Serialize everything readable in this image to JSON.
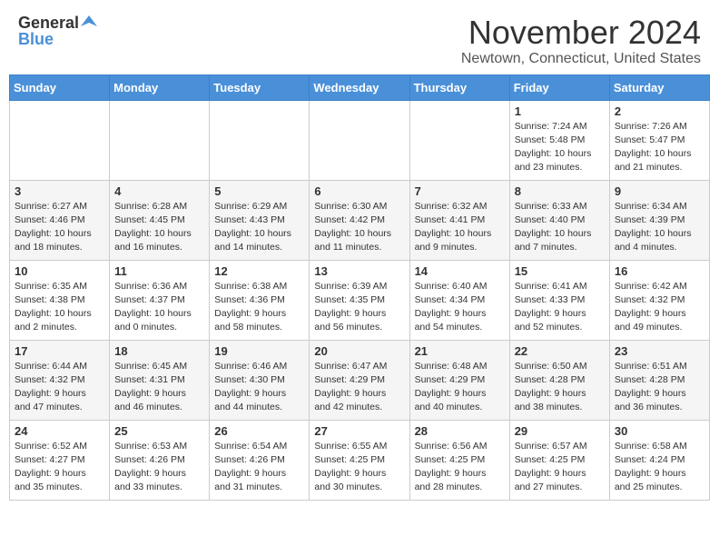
{
  "header": {
    "logo_general": "General",
    "logo_blue": "Blue",
    "month_title": "November 2024",
    "location": "Newtown, Connecticut, United States"
  },
  "days_of_week": [
    "Sunday",
    "Monday",
    "Tuesday",
    "Wednesday",
    "Thursday",
    "Friday",
    "Saturday"
  ],
  "weeks": [
    [
      {
        "day": "",
        "info": ""
      },
      {
        "day": "",
        "info": ""
      },
      {
        "day": "",
        "info": ""
      },
      {
        "day": "",
        "info": ""
      },
      {
        "day": "",
        "info": ""
      },
      {
        "day": "1",
        "info": "Sunrise: 7:24 AM\nSunset: 5:48 PM\nDaylight: 10 hours\nand 23 minutes."
      },
      {
        "day": "2",
        "info": "Sunrise: 7:26 AM\nSunset: 5:47 PM\nDaylight: 10 hours\nand 21 minutes."
      }
    ],
    [
      {
        "day": "3",
        "info": "Sunrise: 6:27 AM\nSunset: 4:46 PM\nDaylight: 10 hours\nand 18 minutes."
      },
      {
        "day": "4",
        "info": "Sunrise: 6:28 AM\nSunset: 4:45 PM\nDaylight: 10 hours\nand 16 minutes."
      },
      {
        "day": "5",
        "info": "Sunrise: 6:29 AM\nSunset: 4:43 PM\nDaylight: 10 hours\nand 14 minutes."
      },
      {
        "day": "6",
        "info": "Sunrise: 6:30 AM\nSunset: 4:42 PM\nDaylight: 10 hours\nand 11 minutes."
      },
      {
        "day": "7",
        "info": "Sunrise: 6:32 AM\nSunset: 4:41 PM\nDaylight: 10 hours\nand 9 minutes."
      },
      {
        "day": "8",
        "info": "Sunrise: 6:33 AM\nSunset: 4:40 PM\nDaylight: 10 hours\nand 7 minutes."
      },
      {
        "day": "9",
        "info": "Sunrise: 6:34 AM\nSunset: 4:39 PM\nDaylight: 10 hours\nand 4 minutes."
      }
    ],
    [
      {
        "day": "10",
        "info": "Sunrise: 6:35 AM\nSunset: 4:38 PM\nDaylight: 10 hours\nand 2 minutes."
      },
      {
        "day": "11",
        "info": "Sunrise: 6:36 AM\nSunset: 4:37 PM\nDaylight: 10 hours\nand 0 minutes."
      },
      {
        "day": "12",
        "info": "Sunrise: 6:38 AM\nSunset: 4:36 PM\nDaylight: 9 hours\nand 58 minutes."
      },
      {
        "day": "13",
        "info": "Sunrise: 6:39 AM\nSunset: 4:35 PM\nDaylight: 9 hours\nand 56 minutes."
      },
      {
        "day": "14",
        "info": "Sunrise: 6:40 AM\nSunset: 4:34 PM\nDaylight: 9 hours\nand 54 minutes."
      },
      {
        "day": "15",
        "info": "Sunrise: 6:41 AM\nSunset: 4:33 PM\nDaylight: 9 hours\nand 52 minutes."
      },
      {
        "day": "16",
        "info": "Sunrise: 6:42 AM\nSunset: 4:32 PM\nDaylight: 9 hours\nand 49 minutes."
      }
    ],
    [
      {
        "day": "17",
        "info": "Sunrise: 6:44 AM\nSunset: 4:32 PM\nDaylight: 9 hours\nand 47 minutes."
      },
      {
        "day": "18",
        "info": "Sunrise: 6:45 AM\nSunset: 4:31 PM\nDaylight: 9 hours\nand 46 minutes."
      },
      {
        "day": "19",
        "info": "Sunrise: 6:46 AM\nSunset: 4:30 PM\nDaylight: 9 hours\nand 44 minutes."
      },
      {
        "day": "20",
        "info": "Sunrise: 6:47 AM\nSunset: 4:29 PM\nDaylight: 9 hours\nand 42 minutes."
      },
      {
        "day": "21",
        "info": "Sunrise: 6:48 AM\nSunset: 4:29 PM\nDaylight: 9 hours\nand 40 minutes."
      },
      {
        "day": "22",
        "info": "Sunrise: 6:50 AM\nSunset: 4:28 PM\nDaylight: 9 hours\nand 38 minutes."
      },
      {
        "day": "23",
        "info": "Sunrise: 6:51 AM\nSunset: 4:28 PM\nDaylight: 9 hours\nand 36 minutes."
      }
    ],
    [
      {
        "day": "24",
        "info": "Sunrise: 6:52 AM\nSunset: 4:27 PM\nDaylight: 9 hours\nand 35 minutes."
      },
      {
        "day": "25",
        "info": "Sunrise: 6:53 AM\nSunset: 4:26 PM\nDaylight: 9 hours\nand 33 minutes."
      },
      {
        "day": "26",
        "info": "Sunrise: 6:54 AM\nSunset: 4:26 PM\nDaylight: 9 hours\nand 31 minutes."
      },
      {
        "day": "27",
        "info": "Sunrise: 6:55 AM\nSunset: 4:25 PM\nDaylight: 9 hours\nand 30 minutes."
      },
      {
        "day": "28",
        "info": "Sunrise: 6:56 AM\nSunset: 4:25 PM\nDaylight: 9 hours\nand 28 minutes."
      },
      {
        "day": "29",
        "info": "Sunrise: 6:57 AM\nSunset: 4:25 PM\nDaylight: 9 hours\nand 27 minutes."
      },
      {
        "day": "30",
        "info": "Sunrise: 6:58 AM\nSunset: 4:24 PM\nDaylight: 9 hours\nand 25 minutes."
      }
    ]
  ]
}
